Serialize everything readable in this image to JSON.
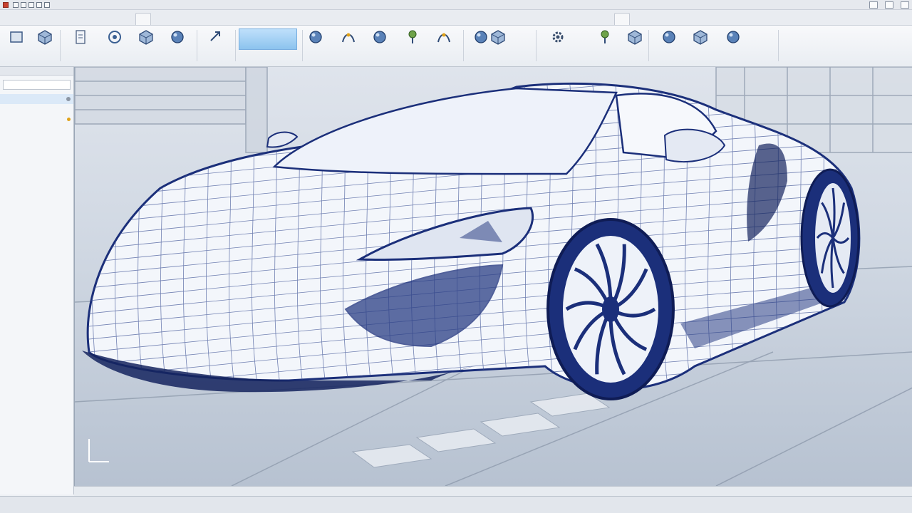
{
  "titlebar": {
    "app_label": "",
    "items": [
      "",
      "",
      "",
      "",
      "",
      ""
    ]
  },
  "ribbon_tabs": [
    "",
    ""
  ],
  "ribbon_tools": [
    {
      "label": "",
      "icon": "new-file-icon"
    },
    {
      "label": "",
      "icon": "open-folder-icon"
    },
    {
      "label": "",
      "icon": "save-icon"
    },
    {
      "label": "",
      "icon": "sketch-icon"
    },
    {
      "label": "",
      "icon": "extrude-icon"
    },
    {
      "label": "",
      "icon": "revolve-icon"
    },
    {
      "label": "",
      "icon": "surface-icon"
    },
    {
      "label": "",
      "icon": "fillet-icon"
    },
    {
      "label": "",
      "icon": "chamfer-icon"
    },
    {
      "label": "",
      "icon": "shell-icon"
    },
    {
      "label": "",
      "icon": "mirror-icon"
    },
    {
      "label": "",
      "icon": "pattern-icon"
    },
    {
      "label": "",
      "icon": "measure-icon"
    },
    {
      "label": "",
      "icon": "section-icon"
    },
    {
      "label": "",
      "icon": "render-icon"
    },
    {
      "label": "",
      "icon": "material-icon"
    },
    {
      "label": "",
      "icon": "light-icon"
    },
    {
      "label": "",
      "icon": "camera-icon"
    },
    {
      "label": "",
      "icon": "assembly-icon"
    },
    {
      "label": "",
      "icon": "settings-icon"
    }
  ],
  "left_panel": {
    "header": "",
    "items": [
      "",
      "",
      "",
      "",
      "",
      "",
      "",
      ""
    ]
  },
  "viewport": {
    "mode": "wireframe",
    "subject": "sports-car-wireframe",
    "mesh_color": "#1b2f7a",
    "background_top": "#dfe4ec",
    "background_bottom": "#b7c2d1"
  },
  "view_tabs": [
    "",
    "",
    "",
    "",
    "",
    "",
    "",
    ""
  ],
  "status": {
    "left": "",
    "right": [
      "",
      "",
      "",
      "",
      "",
      "",
      "",
      ""
    ]
  },
  "colors": {
    "accent": "#8cc3ee",
    "selection": "#dbe9f8",
    "mesh": "#1b2f7a"
  }
}
